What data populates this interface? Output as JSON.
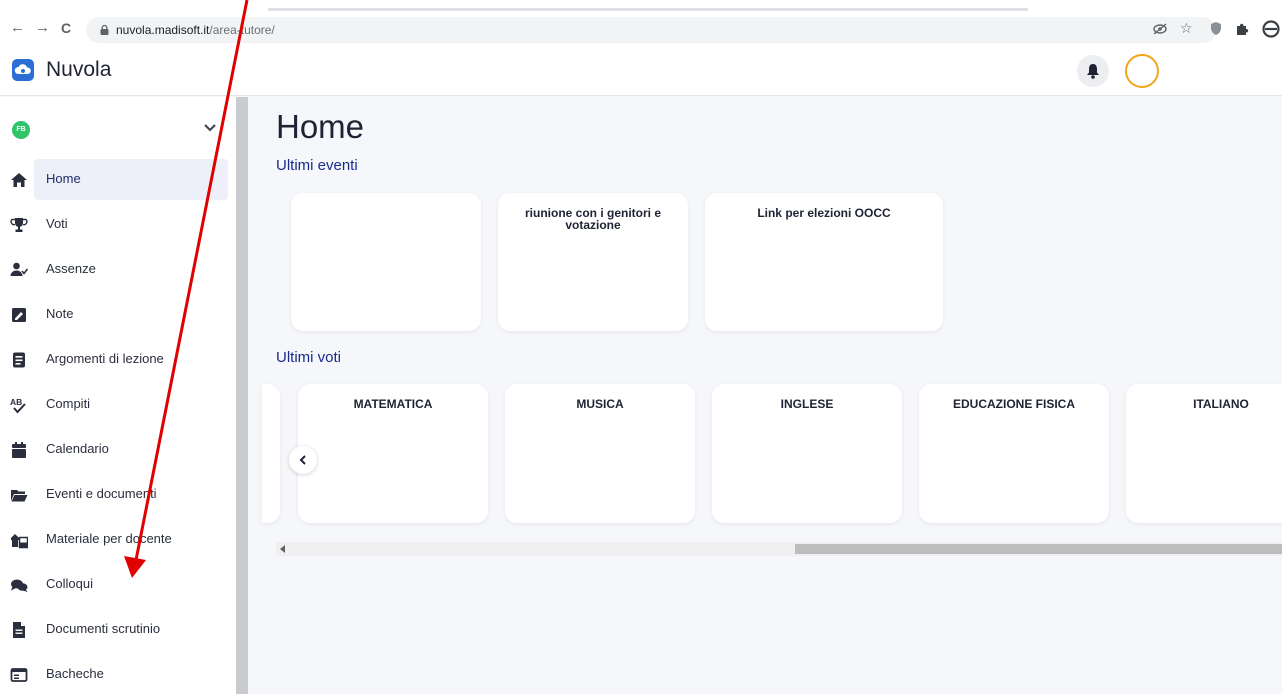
{
  "browser": {
    "url_host": "nuvola.madisoft.it",
    "url_path": "/area-tutore/",
    "back_glyph": "←",
    "forward_glyph": "→",
    "reload_glyph": "C",
    "extension_icons": [
      "eye-off-icon",
      "star-icon",
      "shield-icon",
      "puzzle-icon",
      "profile-icon"
    ]
  },
  "app": {
    "title": "Nuvola",
    "user_initials": "FB",
    "brand_color": "#2b6fd6",
    "avatar_ring_color": "#f2a51a"
  },
  "sidebar": {
    "items": [
      {
        "label": "Home",
        "icon": "home-icon",
        "active": true
      },
      {
        "label": "Voti",
        "icon": "trophy-icon"
      },
      {
        "label": "Assenze",
        "icon": "user-check-icon"
      },
      {
        "label": "Note",
        "icon": "note-icon"
      },
      {
        "label": "Argomenti di lezione",
        "icon": "book-icon"
      },
      {
        "label": "Compiti",
        "icon": "spellcheck-icon"
      },
      {
        "label": "Calendario",
        "icon": "calendar-icon"
      },
      {
        "label": "Eventi e documenti",
        "icon": "folder-icon"
      },
      {
        "label": "Materiale per docente",
        "icon": "share-folder-icon"
      },
      {
        "label": "Colloqui",
        "icon": "chat-icon"
      },
      {
        "label": "Documenti scrutinio",
        "icon": "document-icon"
      },
      {
        "label": "Bacheche",
        "icon": "board-icon"
      }
    ]
  },
  "main": {
    "title": "Home",
    "events_section": {
      "title": "Ultimi eventi",
      "cards": [
        {
          "title": ""
        },
        {
          "title": "riunione con i genitori e votazione"
        },
        {
          "title": "Link per elezioni OOCC"
        }
      ]
    },
    "grades_section": {
      "title": "Ultimi voti",
      "cards": [
        {
          "title": "MATEMATICA"
        },
        {
          "title": "MUSICA"
        },
        {
          "title": "INGLESE"
        },
        {
          "title": "EDUCAZIONE FISICA"
        },
        {
          "title": "ITALIANO"
        }
      ]
    }
  },
  "annotation": {
    "color": "#e00000"
  }
}
